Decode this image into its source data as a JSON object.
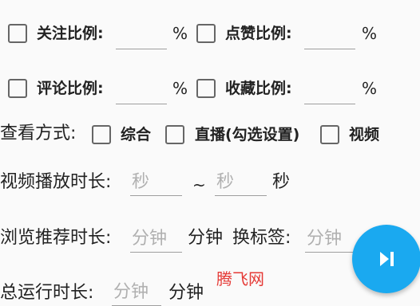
{
  "ratios": {
    "follow": {
      "label": "关注比例:",
      "value": "",
      "unit": "%"
    },
    "like": {
      "label": "点赞比例:",
      "value": "",
      "unit": "%"
    },
    "comment": {
      "label": "评论比例:",
      "value": "",
      "unit": "%"
    },
    "favorite": {
      "label": "收藏比例:",
      "value": "",
      "unit": "%"
    }
  },
  "view_mode": {
    "label": "查看方式:",
    "options": [
      "综合",
      "直播(勾选设置)",
      "视频"
    ]
  },
  "video_duration": {
    "label": "视频播放时长:",
    "min_placeholder": "秒",
    "separator": "~",
    "max_placeholder": "秒",
    "unit": "秒"
  },
  "browse_duration": {
    "label": "浏览推荐时长:",
    "placeholder": "分钟",
    "unit": "分钟",
    "switch_tab_label": "换标签:",
    "switch_tab_placeholder": "分钟"
  },
  "total_runtime": {
    "label": "总运行时长:",
    "placeholder": "分钟",
    "unit": "分钟"
  },
  "fab": {
    "icon": "skip-next-icon",
    "color": "#1aa9f0"
  },
  "watermark": "腾飞网"
}
